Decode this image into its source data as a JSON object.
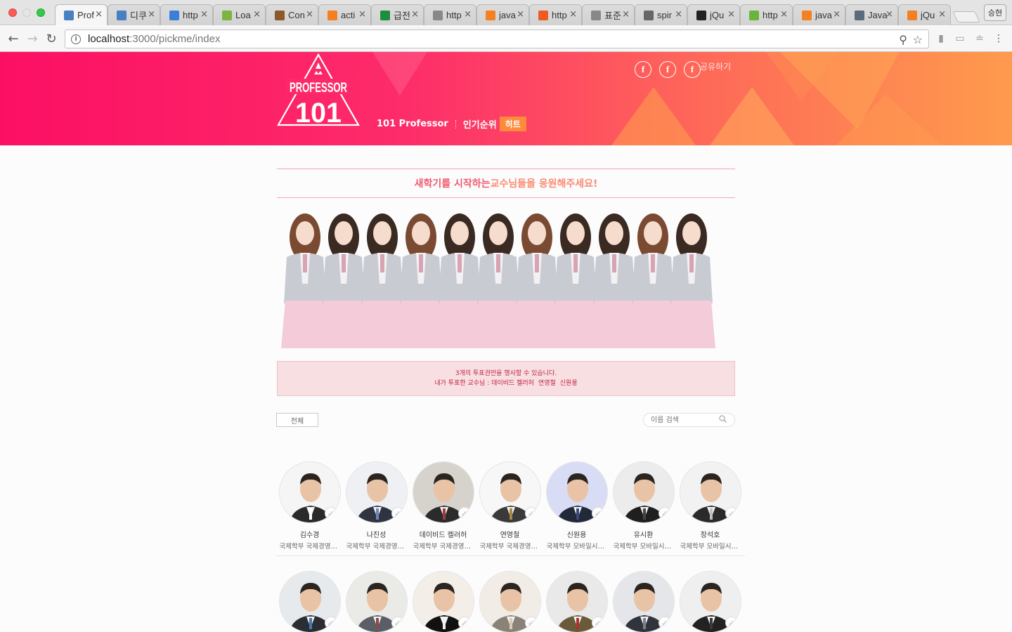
{
  "browser": {
    "tabs": [
      {
        "label": "Prof",
        "icon": "doc-blue-icon",
        "active": true
      },
      {
        "label": "디쿠",
        "icon": "doc-blue-icon"
      },
      {
        "label": "http",
        "icon": "gear-blue-icon"
      },
      {
        "label": "Loa",
        "icon": "u-green-icon"
      },
      {
        "label": "Con",
        "icon": "table-icon"
      },
      {
        "label": "acti",
        "icon": "stack-icon"
      },
      {
        "label": "급전",
        "icon": "sheet-green-icon"
      },
      {
        "label": "http",
        "icon": "page-icon"
      },
      {
        "label": "java",
        "icon": "stack-icon"
      },
      {
        "label": "http",
        "icon": "orange-circle-icon"
      },
      {
        "label": "표준",
        "icon": "page-icon"
      },
      {
        "label": "spir",
        "icon": "spinner-icon"
      },
      {
        "label": "jQu",
        "icon": "s-box-icon"
      },
      {
        "label": "http",
        "icon": "green-face-icon"
      },
      {
        "label": "java",
        "icon": "stack-icon"
      },
      {
        "label": "Java",
        "icon": "globe-icon"
      },
      {
        "label": "jQu",
        "icon": "stack-icon"
      }
    ],
    "profile_label": "승현",
    "url_host": "localhost",
    "url_rest": ":3000/pickme/index"
  },
  "header": {
    "logo_text_top": "PROFESSOR",
    "logo_text_num": "101",
    "nav": {
      "item1": "101 Professor",
      "item2": "인기순위",
      "hot_badge": "히트"
    },
    "share_label": "공유하기",
    "share_icon_letter": "f"
  },
  "headline": {
    "part1": "새학기를 시작하는 ",
    "part2": "교수님들을 응원해주세요!"
  },
  "vote": {
    "line1": "3개의 투표권만을 행사할 수 있습니다.",
    "prefix": "내가 투표한 교수님 : ",
    "voted": [
      "데이비드 켈러허",
      "연영철",
      "신원용"
    ]
  },
  "filter": {
    "all_label": "전체",
    "search_placeholder": "이름 검색"
  },
  "professors_row1": [
    {
      "name": "김수경",
      "dept": "국제학부 국제경영학과"
    },
    {
      "name": "나진성",
      "dept": "국제학부 국제경영학과"
    },
    {
      "name": "데이비드 켈러허",
      "dept": "국제학부 국제경영학과"
    },
    {
      "name": "연영철",
      "dept": "국제학부 국제경영학과"
    },
    {
      "name": "신원용",
      "dept": "국제학부 모바일시스템공학과"
    },
    {
      "name": "유시환",
      "dept": "국제학부 모바일시스템공학과"
    },
    {
      "name": "장석호",
      "dept": "국제학부 모바일시스템공학과"
    }
  ],
  "colors": {
    "banner_start": "#fc0f63",
    "banner_end": "#fe9b4d",
    "accent_pink": "#f05a6e",
    "accent_orange": "#fa8b73",
    "vote_text": "#c4213f"
  }
}
